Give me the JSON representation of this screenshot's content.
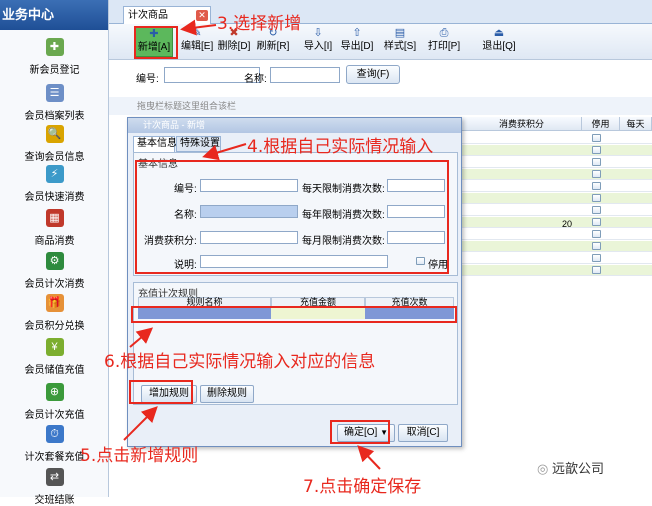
{
  "sidebar": {
    "title": "业务中心",
    "items": [
      {
        "label": "新会员登记",
        "icon": "member-register-icon",
        "color": "#6aa84f"
      },
      {
        "label": "会员档案列表",
        "icon": "list-icon",
        "color": "#6d8fc7"
      },
      {
        "label": "查询会员信息",
        "icon": "search-icon",
        "color": "#d9a400"
      },
      {
        "label": "会员快速消费",
        "icon": "fast-consume-icon",
        "color": "#3c9ac9"
      },
      {
        "label": "商品消费",
        "icon": "goods-icon",
        "color": "#c0392b"
      },
      {
        "label": "会员计次消费",
        "icon": "count-consume-icon",
        "color": "#2e8b3e"
      },
      {
        "label": "会员积分兑换",
        "icon": "gift-icon",
        "color": "#e69138"
      },
      {
        "label": "会员储值充值",
        "icon": "coin-icon",
        "color": "#7cae2f"
      },
      {
        "label": "会员计次充值",
        "icon": "plus-circle-icon",
        "color": "#3b9a3b"
      },
      {
        "label": "计次套餐充值",
        "icon": "package-icon",
        "color": "#3c78c9"
      },
      {
        "label": "交班结账",
        "icon": "shift-icon",
        "color": "#555555"
      }
    ]
  },
  "tab": {
    "label": "计次商品"
  },
  "toolbar": [
    {
      "label": "新增[A]",
      "icon": "add-icon"
    },
    {
      "label": "编辑[E]",
      "icon": "edit-icon"
    },
    {
      "label": "删除[D]",
      "icon": "delete-icon"
    },
    {
      "label": "刷新[R]",
      "icon": "refresh-icon"
    },
    {
      "label": "导入[I]",
      "icon": "import-icon"
    },
    {
      "label": "导出[D]",
      "icon": "export-icon"
    },
    {
      "label": "样式[S]",
      "icon": "style-icon"
    },
    {
      "label": "打印[P]",
      "icon": "print-icon"
    },
    {
      "label": "退出[Q]",
      "icon": "exit-icon"
    }
  ],
  "search": {
    "code_label": "编号:",
    "name_label": "名称:",
    "query_label": "查询(F)"
  },
  "group_hint": "拖曳栏标题这里组合该栏",
  "grid": {
    "columns": [
      "消费获积分",
      "停用",
      "每天"
    ],
    "points_value": "20"
  },
  "dialog": {
    "title": "计次商品 - 新增",
    "tabs": [
      "基本信息",
      "特殊设置"
    ],
    "basic_caption": "基本信息",
    "fields": {
      "code": "编号:",
      "name": "名称:",
      "points": "消费获积分:",
      "note": "说明:",
      "daily_limit": "每天限制消费次数:",
      "yearly_limit": "每年限制消费次数:",
      "monthly_limit": "每月限制消费次数:",
      "disabled": "停用"
    },
    "recharge_caption": "充值计次规则",
    "recharge_columns": [
      "规则名称",
      "充值金额",
      "充值次数"
    ],
    "add_rule": "增加规则",
    "delete_rule": "删除规则",
    "ok": "确定[O]",
    "cancel": "取消[C]"
  },
  "annotations": {
    "step3": "3.选择新增",
    "step4": "4.根据自己实际情况输入",
    "step6": "6.根据自己实际情况输入对应的信息",
    "step5": "5.点击新增规则",
    "step7": "7.点击确定保存"
  },
  "watermark": "远歆公司",
  "colors": {
    "accent": "#e8281e",
    "header": "#2a5ca8",
    "row_alt": "#eaf5d8"
  }
}
